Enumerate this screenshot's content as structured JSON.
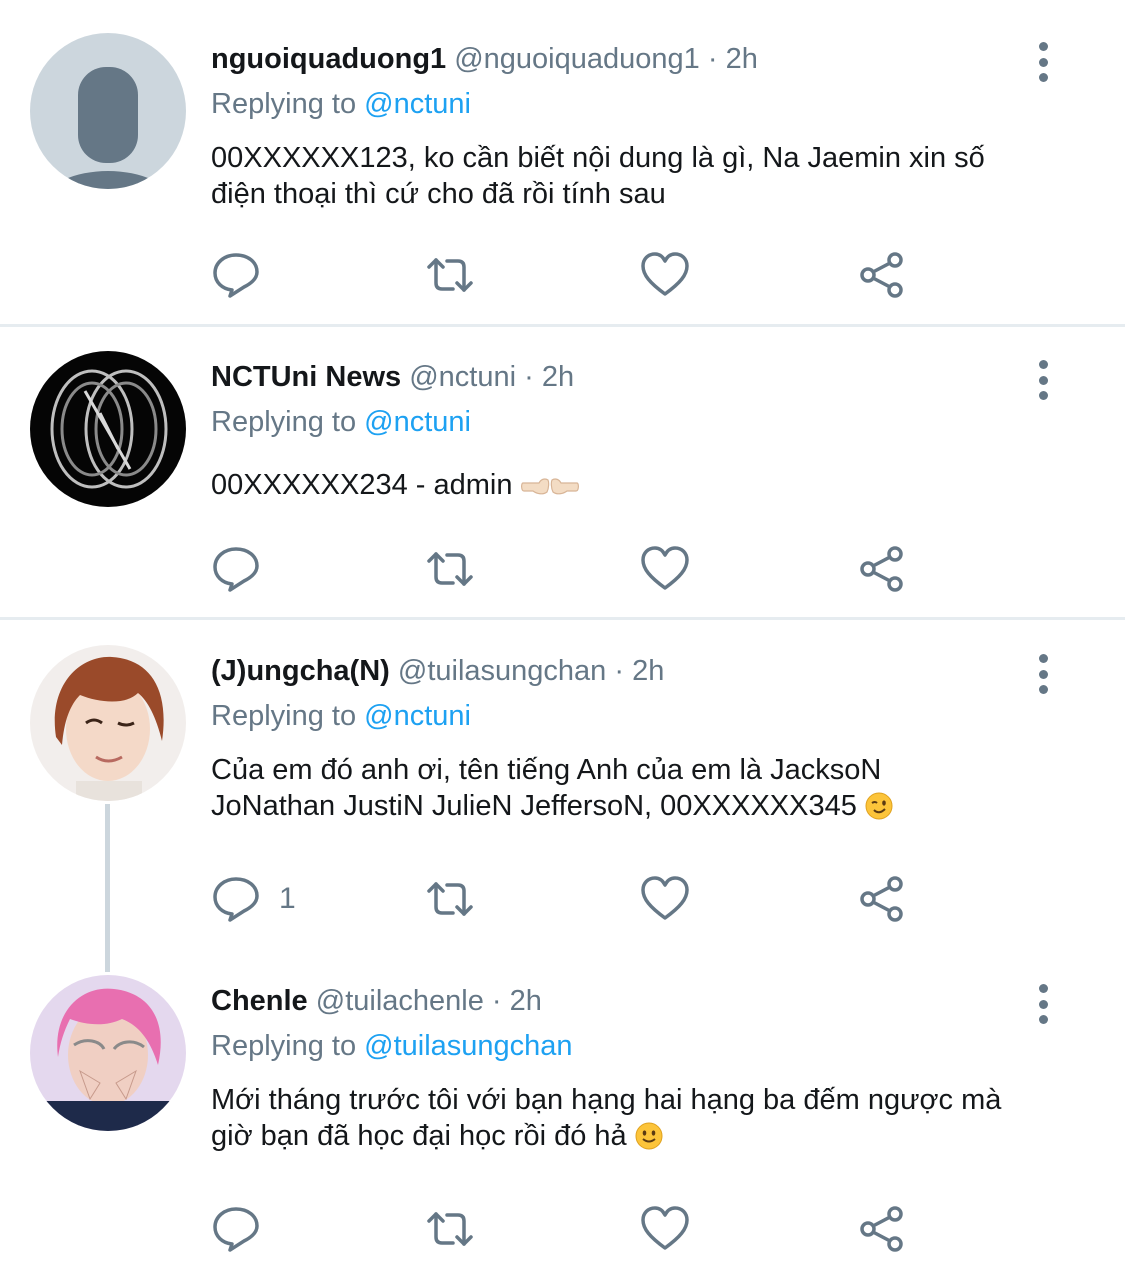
{
  "tweets": [
    {
      "name": "nguoiquaduong1",
      "handle": "@nguoiquaduong1",
      "dot": "·",
      "time": "2h",
      "replying_label": "Replying to",
      "replying_to": "@nctuni",
      "text_line1": "00XXXXXX123, ko cần biết nội dung là gì, Na Jaemin xin số",
      "text_line2": "điện thoại thì cứ cho đã rồi tính sau",
      "avatar": "default-avatar",
      "reply_count": ""
    },
    {
      "name": "NCTUni News",
      "handle": "@nctuni",
      "dot": "·",
      "time": "2h",
      "replying_label": "Replying to",
      "replying_to": "@nctuni",
      "text_line1": "00XXXXXX234 - admin",
      "text_emoji": "pointing-fingers-emoji",
      "avatar": "nct-logo-avatar",
      "reply_count": ""
    },
    {
      "name": "(J)ungcha(N)",
      "handle": "@tuilasungchan",
      "dot": "·",
      "time": "2h",
      "replying_label": "Replying to",
      "replying_to": "@nctuni",
      "text_line1": "Của em đó anh ơi, tên tiếng Anh của em là JacksoN",
      "text_line2": "JoNathan JustiN JulieN JeffersoN, 00XXXXXX345",
      "text_emoji": "winking-face-emoji",
      "avatar": "photo-avatar-boy-wink",
      "reply_count": "1"
    },
    {
      "name": "Chenle",
      "handle": "@tuilachenle",
      "dot": "·",
      "time": "2h",
      "replying_label": "Replying to",
      "replying_to": "@tuilasungchan",
      "text_line1": "Mới tháng trước tôi với bạn hạng hai hạng ba đếm ngược mà",
      "text_line2": "giờ bạn đã học đại học rồi đó hả",
      "text_emoji": "slightly-smiling-face-emoji",
      "avatar": "photo-avatar-pink-hair",
      "reply_count": ""
    }
  ],
  "icons": {
    "reply": "reply-icon",
    "retweet": "retweet-icon",
    "like": "heart-icon",
    "share": "share-icon",
    "more": "more-options-icon"
  },
  "colors": {
    "link": "#1da1f2",
    "secondary": "#657786",
    "divider": "#e6ecf0",
    "thread_line": "#ccd6dd"
  }
}
